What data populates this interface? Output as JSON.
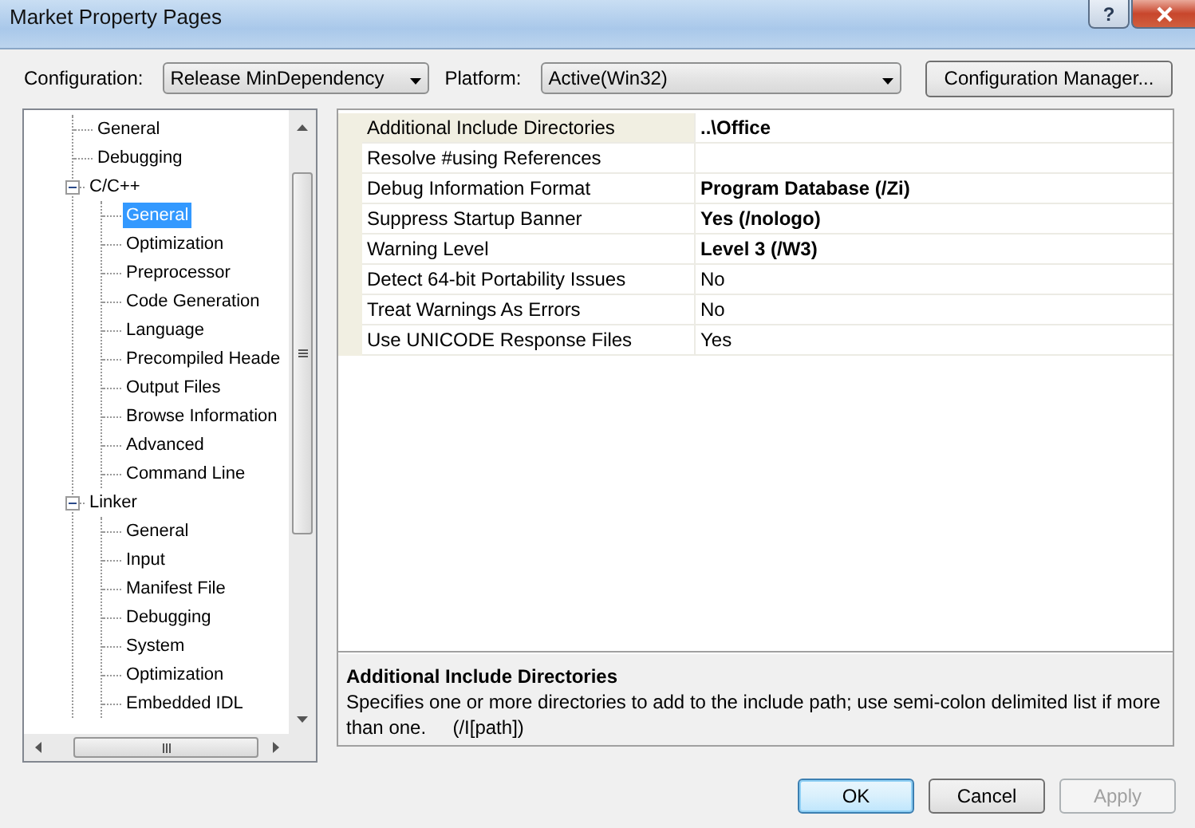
{
  "window": {
    "title": "Market Property Pages",
    "help_button": "?"
  },
  "configuration": {
    "label": "Configuration:",
    "value": "Release MinDependency"
  },
  "platform": {
    "label": "Platform:",
    "value": "Active(Win32)"
  },
  "configuration_manager_button": "Configuration Manager...",
  "tree": [
    {
      "label": "General",
      "selected": false
    },
    {
      "label": "Debugging",
      "selected": false
    },
    {
      "label": "C/C++",
      "selected": false,
      "expanded": true,
      "children": [
        {
          "label": "General",
          "selected": true
        },
        {
          "label": "Optimization",
          "selected": false
        },
        {
          "label": "Preprocessor",
          "selected": false
        },
        {
          "label": "Code Generation",
          "selected": false
        },
        {
          "label": "Language",
          "selected": false
        },
        {
          "label": "Precompiled Heade",
          "selected": false
        },
        {
          "label": "Output Files",
          "selected": false
        },
        {
          "label": "Browse Information",
          "selected": false
        },
        {
          "label": "Advanced",
          "selected": false
        },
        {
          "label": "Command Line",
          "selected": false
        }
      ]
    },
    {
      "label": "Linker",
      "selected": false,
      "expanded": true,
      "children": [
        {
          "label": "General",
          "selected": false
        },
        {
          "label": "Input",
          "selected": false
        },
        {
          "label": "Manifest File",
          "selected": false
        },
        {
          "label": "Debugging",
          "selected": false
        },
        {
          "label": "System",
          "selected": false
        },
        {
          "label": "Optimization",
          "selected": false
        },
        {
          "label": "Embedded IDL",
          "selected": false
        }
      ]
    }
  ],
  "properties": [
    {
      "name": "Additional Include Directories",
      "value": "..\\Office",
      "modified": true,
      "selected": true
    },
    {
      "name": "Resolve #using References",
      "selected": false
    },
    {
      "name": "Debug Information Format",
      "value": "Program Database (/Zi)",
      "modified": true,
      "selected": false
    },
    {
      "name": "Suppress Startup Banner",
      "value": "Yes (/nologo)",
      "modified": true,
      "selected": false
    },
    {
      "name": "Warning Level",
      "value": "Level 3 (/W3)",
      "modified": true,
      "selected": false
    },
    {
      "name": "Detect 64-bit Portability Issues",
      "value": "No",
      "modified": false,
      "selected": false
    },
    {
      "name": "Treat Warnings As Errors",
      "value": "No",
      "modified": false,
      "selected": false
    },
    {
      "name": "Use UNICODE Response Files",
      "value": "Yes",
      "modified": false,
      "selected": false
    }
  ],
  "description": {
    "title": "Additional Include Directories",
    "text": "Specifies one or more directories to add to the include path; use semi-colon delimited list if more than one.     (/I[path])"
  },
  "buttons": [
    {
      "label": "OK",
      "default": true,
      "disabled": false
    },
    {
      "label": "Cancel",
      "default": false,
      "disabled": false
    },
    {
      "label": "Apply",
      "default": false,
      "disabled": true
    }
  ]
}
